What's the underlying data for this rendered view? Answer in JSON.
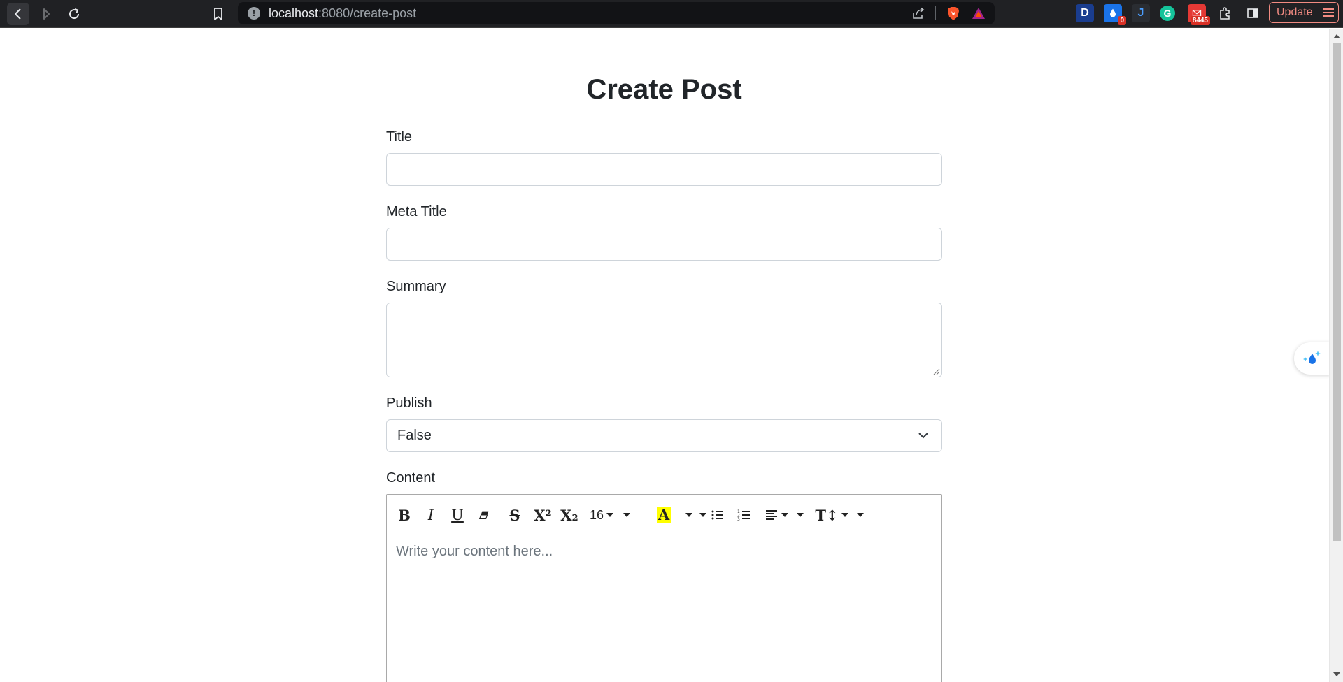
{
  "browser": {
    "url_host": "localhost",
    "url_path": ":8080/create-post",
    "update_label": "Update",
    "extensions": [
      {
        "name": "dashlane-icon",
        "label": "D",
        "color": "#1a3d8f"
      },
      {
        "name": "drop-extension-icon",
        "label": "",
        "color": "#1a73e8",
        "badge": "0"
      },
      {
        "name": "j-extension-icon",
        "label": "J",
        "color": "#2a2d32"
      },
      {
        "name": "grammarly-icon",
        "label": "G",
        "color": "#15c39a"
      },
      {
        "name": "mail-extension-icon",
        "label": "",
        "color": "#e53935",
        "badge": "8445"
      }
    ]
  },
  "page": {
    "title": "Create Post"
  },
  "form": {
    "title_label": "Title",
    "title_value": "",
    "meta_title_label": "Meta Title",
    "meta_title_value": "",
    "summary_label": "Summary",
    "summary_value": "",
    "publish_label": "Publish",
    "publish_value": "False",
    "content_label": "Content",
    "content_placeholder": "Write your content here..."
  },
  "editor_toolbar": {
    "bold": "B",
    "italic": "I",
    "underline": "U",
    "strikethrough": "S",
    "superscript": "X²",
    "subscript": "X₂",
    "font_size": "16",
    "text_style": "T↕"
  }
}
